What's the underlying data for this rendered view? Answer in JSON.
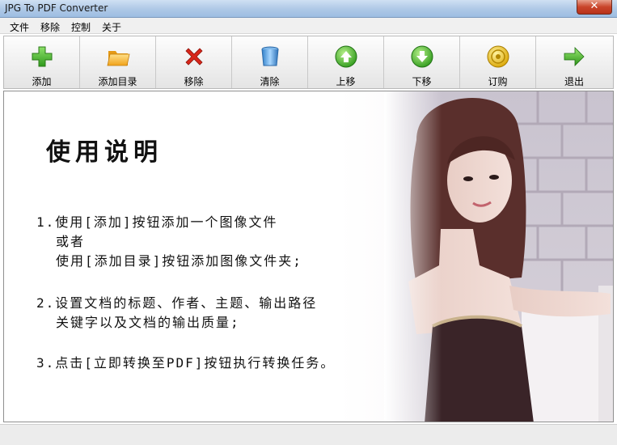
{
  "window": {
    "title": "JPG To PDF Converter",
    "close_label": "✕"
  },
  "menu": [
    "文件",
    "移除",
    "控制",
    "关于"
  ],
  "toolbar": [
    {
      "label": "添加",
      "icon": "add-plus-icon"
    },
    {
      "label": "添加目录",
      "icon": "folder-icon"
    },
    {
      "label": "移除",
      "icon": "red-x-icon"
    },
    {
      "label": "清除",
      "icon": "trash-bin-icon"
    },
    {
      "label": "上移",
      "icon": "up-arrow-icon"
    },
    {
      "label": "下移",
      "icon": "down-arrow-icon"
    },
    {
      "label": "订购",
      "icon": "gold-coin-icon"
    },
    {
      "label": "退出",
      "icon": "exit-arrow-icon"
    }
  ],
  "content": {
    "heading": "使用说明",
    "lines": [
      "1.使用[添加]按钮添加一个图像文件",
      "或者",
      "使用[添加目录]按钮添加图像文件夹;",
      "2.设置文档的标题、作者、主题、输出路径",
      "关键字以及文档的输出质量;",
      "3.点击[立即转换至PDF]按钮执行转换任务。"
    ]
  },
  "colors": {
    "titlebar": "#aec8e6",
    "close_button": "#c9452b",
    "toolbar_bg": "#eeeeee"
  }
}
